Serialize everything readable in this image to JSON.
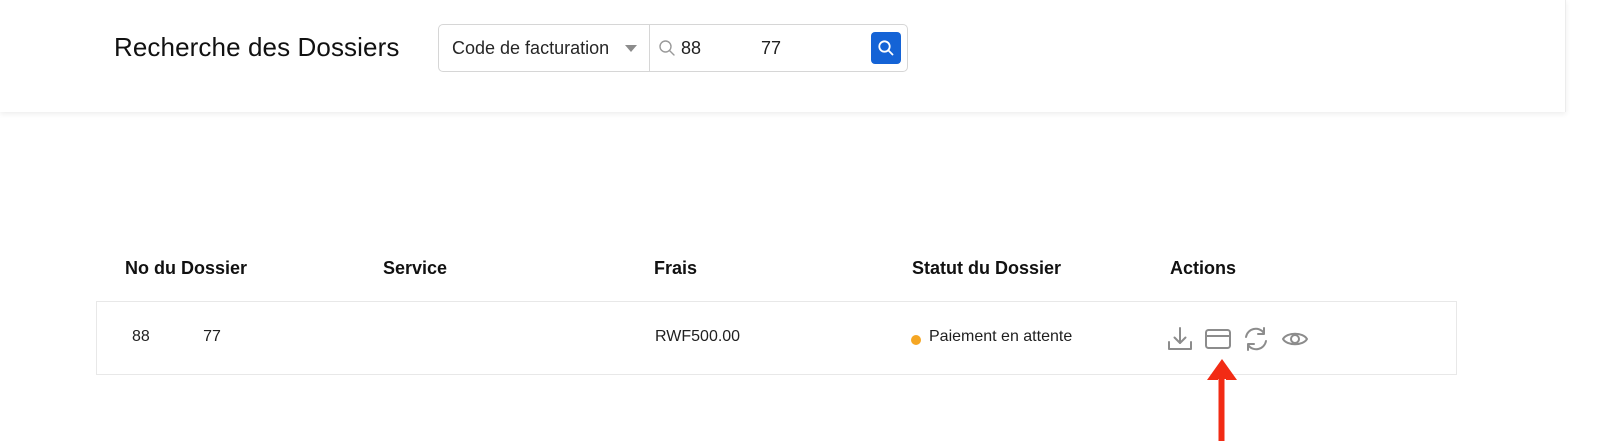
{
  "header": {
    "title": "Recherche des Dossiers",
    "search": {
      "filter_selected": "Code de facturation",
      "query": "88            77"
    }
  },
  "table": {
    "columns": [
      "No du Dossier",
      "Service",
      "Frais",
      "Statut du Dossier",
      "Actions"
    ],
    "rows": [
      {
        "dossier_no": "88            77",
        "service": "",
        "frais": "RWF500.00",
        "statut": "Paiement en attente"
      }
    ]
  },
  "icons": {
    "search": "search-icon",
    "actions": [
      "download-icon",
      "card-payment-icon",
      "refresh-icon",
      "eye-icon"
    ]
  },
  "colors": {
    "accent": "#1463d6",
    "status_pending": "#f5a623",
    "icon_gray": "#8c8c8c",
    "annotation_arrow": "#f22b14"
  }
}
